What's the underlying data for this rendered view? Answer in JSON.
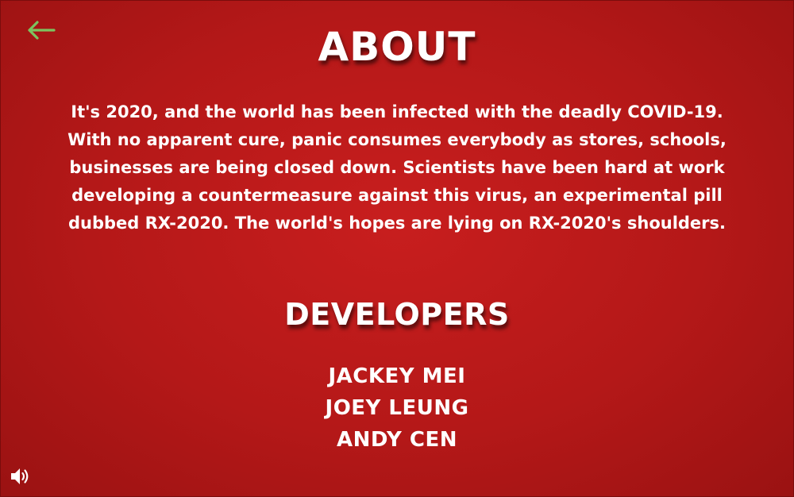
{
  "nav": {
    "back_icon": "arrow-left-icon",
    "back_color": "#7cc35f"
  },
  "about": {
    "title": "ABOUT",
    "lines": [
      "It's 2020, and the world has been infected with the deadly COVID-19.",
      "With no apparent cure, panic consumes everybody as stores, schools,",
      "businesses are being closed down. Scientists have been hard at work",
      "developing a countermeasure against this virus, an experimental pill",
      "dubbed RX-2020. The world's hopes are lying on RX-2020's shoulders."
    ]
  },
  "developers": {
    "title": "DEVELOPERS",
    "names": [
      "JACKEY MEI",
      "JOEY LEUNG",
      "ANDY CEN"
    ]
  },
  "sound": {
    "icon": "speaker-volume-icon"
  },
  "colors": {
    "background": "#b41818",
    "text": "#ffffff"
  }
}
